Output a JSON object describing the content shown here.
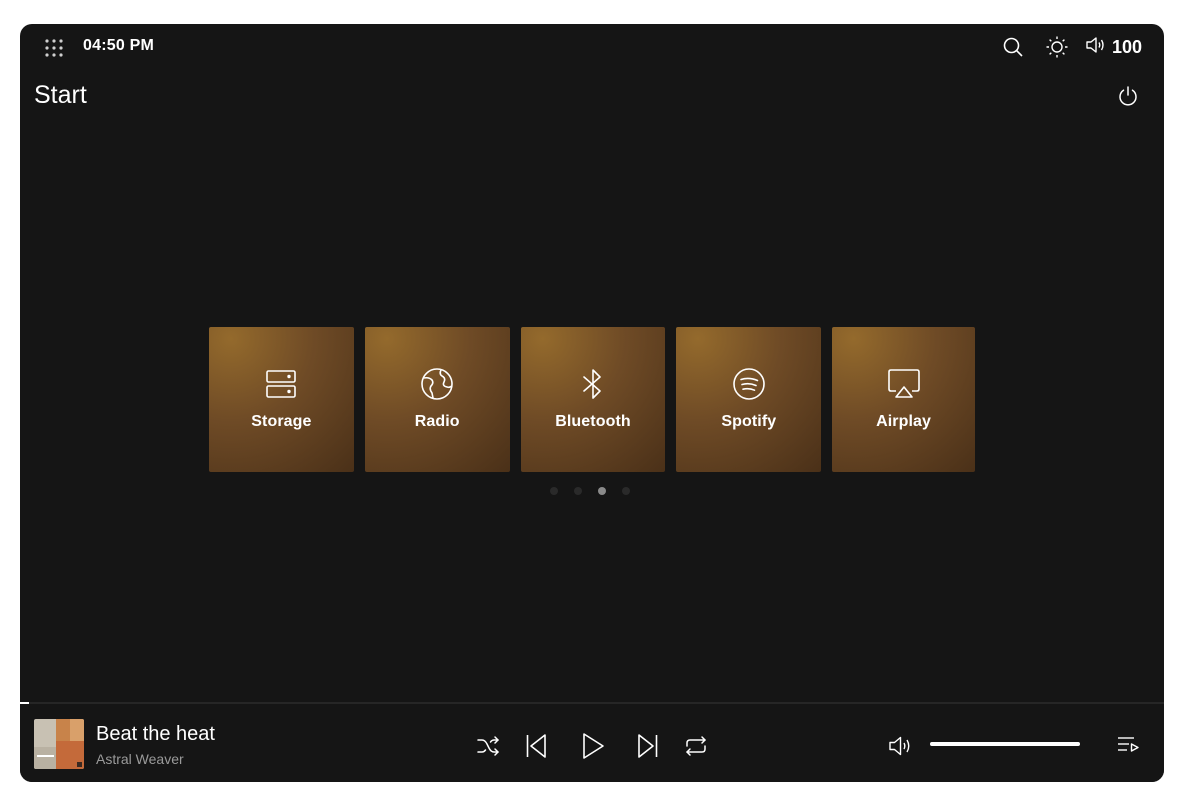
{
  "status_bar": {
    "time": "04:50 PM",
    "volume_level": "100",
    "icons": [
      "apps-grid-icon",
      "search-icon",
      "brightness-icon",
      "volume-icon"
    ]
  },
  "page": {
    "title": "Start",
    "power_icon": "power-icon"
  },
  "sources": [
    {
      "label": "Storage",
      "icon": "storage-icon"
    },
    {
      "label": "Radio",
      "icon": "globe-icon"
    },
    {
      "label": "Bluetooth",
      "icon": "bluetooth-icon"
    },
    {
      "label": "Spotify",
      "icon": "spotify-icon"
    },
    {
      "label": "Airplay",
      "icon": "airplay-icon"
    }
  ],
  "pager": {
    "count": 4,
    "active_index": 2
  },
  "player": {
    "track_title": "Beat the heat",
    "artist": "Astral Weaver",
    "progress_fraction": 0.008,
    "volume_fraction": 1.0,
    "controls": [
      "shuffle-icon",
      "previous-icon",
      "play-icon",
      "next-icon",
      "repeat-icon"
    ]
  },
  "colors": {
    "background": "#151515",
    "tile_gradient_light": "#946a2c",
    "tile_gradient_dark": "#4a3018",
    "text": "#ffffff",
    "muted_text": "#9a9a9a"
  }
}
